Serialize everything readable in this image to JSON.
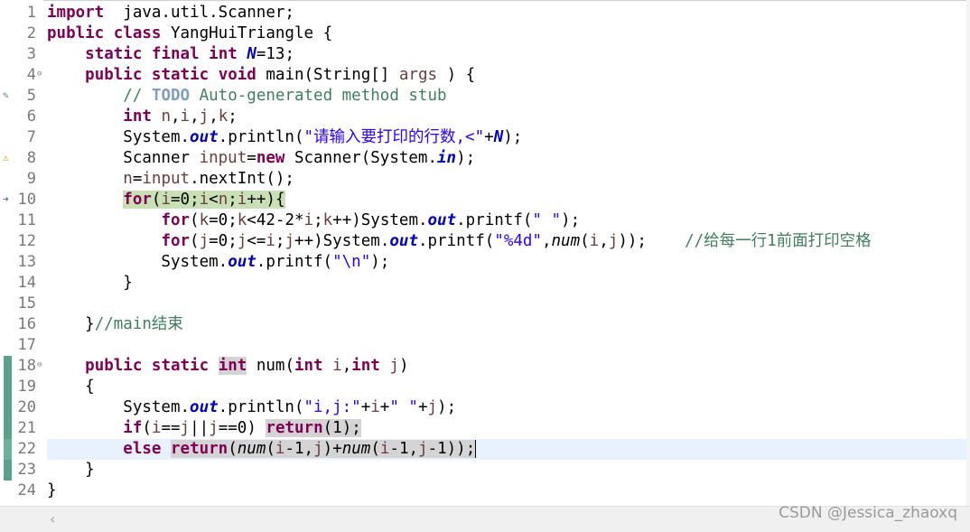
{
  "editor": {
    "lines": [
      {
        "n": "1",
        "parts": [
          [
            "kw",
            "import"
          ],
          [
            "",
            "  java.util.Scanner;"
          ]
        ]
      },
      {
        "n": "2",
        "parts": [
          [
            "kw",
            "public"
          ],
          [
            "",
            " "
          ],
          [
            "kw",
            "class"
          ],
          [
            "",
            " YangHuiTriangle {"
          ]
        ]
      },
      {
        "n": "3",
        "parts": [
          [
            "",
            "    "
          ],
          [
            "kw",
            "static"
          ],
          [
            "",
            " "
          ],
          [
            "kw",
            "final"
          ],
          [
            "",
            " "
          ],
          [
            "kw",
            "int"
          ],
          [
            "",
            " "
          ],
          [
            "fld",
            "N"
          ],
          [
            "",
            "=13;"
          ]
        ]
      },
      {
        "n": "4",
        "parts": [
          [
            "",
            "    "
          ],
          [
            "kw",
            "public"
          ],
          [
            "",
            " "
          ],
          [
            "kw",
            "static"
          ],
          [
            "",
            " "
          ],
          [
            "kw",
            "void"
          ],
          [
            "",
            " main(String[] "
          ],
          [
            "var",
            "args"
          ],
          [
            "",
            " ) {"
          ]
        ]
      },
      {
        "n": "5",
        "parts": [
          [
            "",
            "        "
          ],
          [
            "cmt",
            "// "
          ],
          [
            "todo",
            "TODO"
          ],
          [
            "cmt",
            " Auto-generated method stub"
          ]
        ]
      },
      {
        "n": "6",
        "parts": [
          [
            "",
            "        "
          ],
          [
            "kw",
            "int"
          ],
          [
            "",
            " "
          ],
          [
            "var",
            "n"
          ],
          [
            "",
            ","
          ],
          [
            "var",
            "i"
          ],
          [
            "",
            ","
          ],
          [
            "var",
            "j"
          ],
          [
            "",
            ","
          ],
          [
            "var",
            "k"
          ],
          [
            "",
            ";"
          ]
        ]
      },
      {
        "n": "7",
        "parts": [
          [
            "",
            "        System."
          ],
          [
            "fld",
            "out"
          ],
          [
            "",
            ".println("
          ],
          [
            "str",
            "\"请输入要打印的行数,<\""
          ],
          [
            "",
            "+"
          ],
          [
            "fld",
            "N"
          ],
          [
            "",
            ");"
          ]
        ]
      },
      {
        "n": "8",
        "parts": [
          [
            "",
            "        Scanner "
          ],
          [
            "var",
            "input"
          ],
          [
            "",
            "="
          ],
          [
            "kw",
            "new"
          ],
          [
            "",
            " Scanner(System."
          ],
          [
            "fld",
            "in"
          ],
          [
            "",
            ");"
          ]
        ]
      },
      {
        "n": "9",
        "parts": [
          [
            "",
            "        "
          ],
          [
            "var",
            "n"
          ],
          [
            "",
            "="
          ],
          [
            "var",
            "input"
          ],
          [
            "",
            ".nextInt();"
          ]
        ]
      },
      {
        "n": "10",
        "parts": [
          [
            "",
            "        "
          ],
          [
            "hlkw",
            "for"
          ],
          [
            "hl",
            "("
          ],
          [
            "hlvar",
            "i"
          ],
          [
            "hl",
            "=0;"
          ],
          [
            "hlvar",
            "i"
          ],
          [
            "hl",
            "<"
          ],
          [
            "hlvar",
            "n"
          ],
          [
            "hl",
            ";"
          ],
          [
            "hlvar",
            "i"
          ],
          [
            "hl",
            "++){"
          ]
        ]
      },
      {
        "n": "11",
        "parts": [
          [
            "",
            "            "
          ],
          [
            "kw",
            "for"
          ],
          [
            "",
            "("
          ],
          [
            "var",
            "k"
          ],
          [
            "",
            "=0;"
          ],
          [
            "var",
            "k"
          ],
          [
            "",
            "<42-2*"
          ],
          [
            "var",
            "i"
          ],
          [
            "",
            ";"
          ],
          [
            "var",
            "k"
          ],
          [
            "",
            "++)System."
          ],
          [
            "fld",
            "out"
          ],
          [
            "",
            ".printf("
          ],
          [
            "str",
            "\" \""
          ],
          [
            "",
            ");"
          ]
        ]
      },
      {
        "n": "12",
        "parts": [
          [
            "",
            "            "
          ],
          [
            "kw",
            "for"
          ],
          [
            "",
            "("
          ],
          [
            "var",
            "j"
          ],
          [
            "",
            "=0;"
          ],
          [
            "var",
            "j"
          ],
          [
            "",
            "<="
          ],
          [
            "var",
            "i"
          ],
          [
            "",
            ";"
          ],
          [
            "var",
            "j"
          ],
          [
            "",
            "++)System."
          ],
          [
            "fld",
            "out"
          ],
          [
            "",
            ".printf("
          ],
          [
            "str",
            "\"%4d\""
          ],
          [
            "",
            ","
          ],
          [
            "mcall",
            "num"
          ],
          [
            "",
            "("
          ],
          [
            "var",
            "i"
          ],
          [
            "",
            ","
          ],
          [
            "var",
            "j"
          ],
          [
            "",
            "));    "
          ],
          [
            "cmt",
            "//给每一行1前面打印空格"
          ]
        ]
      },
      {
        "n": "13",
        "parts": [
          [
            "",
            "            System."
          ],
          [
            "fld",
            "out"
          ],
          [
            "",
            ".printf("
          ],
          [
            "str",
            "\"\\n\""
          ],
          [
            "",
            ");"
          ]
        ]
      },
      {
        "n": "14",
        "parts": [
          [
            "",
            "        }"
          ]
        ]
      },
      {
        "n": "15",
        "parts": []
      },
      {
        "n": "16",
        "parts": [
          [
            "",
            "    }"
          ],
          [
            "cmt",
            "//main结束"
          ]
        ]
      },
      {
        "n": "17",
        "parts": []
      },
      {
        "n": "18",
        "parts": [
          [
            "",
            "    "
          ],
          [
            "kw",
            "public"
          ],
          [
            "",
            " "
          ],
          [
            "kw",
            "static"
          ],
          [
            "",
            " "
          ],
          [
            "gkw",
            "int"
          ],
          [
            "",
            " num("
          ],
          [
            "kw",
            "int"
          ],
          [
            "",
            " "
          ],
          [
            "var",
            "i"
          ],
          [
            "",
            ","
          ],
          [
            "kw",
            "int"
          ],
          [
            "",
            " "
          ],
          [
            "var",
            "j"
          ],
          [
            "",
            ")"
          ]
        ]
      },
      {
        "n": "19",
        "parts": [
          [
            "",
            "    {"
          ]
        ]
      },
      {
        "n": "20",
        "parts": [
          [
            "",
            "        System."
          ],
          [
            "fld",
            "out"
          ],
          [
            "",
            ".println("
          ],
          [
            "str",
            "\"i,j:\""
          ],
          [
            "",
            "+"
          ],
          [
            "var",
            "i"
          ],
          [
            "",
            "+"
          ],
          [
            "str",
            "\" \""
          ],
          [
            "",
            "+"
          ],
          [
            "var",
            "j"
          ],
          [
            "",
            ");"
          ]
        ]
      },
      {
        "n": "21",
        "parts": [
          [
            "",
            "        "
          ],
          [
            "kw",
            "if"
          ],
          [
            "",
            "("
          ],
          [
            "var",
            "i"
          ],
          [
            "",
            "=="
          ],
          [
            "var",
            "j"
          ],
          [
            "",
            "||"
          ],
          [
            "var",
            "j"
          ],
          [
            "",
            "==0) "
          ],
          [
            "gkw",
            "return"
          ],
          [
            "g",
            "(1);"
          ]
        ]
      },
      {
        "n": "22",
        "parts": [
          [
            "",
            "        "
          ],
          [
            "kw",
            "else"
          ],
          [
            "",
            " "
          ],
          [
            "gkw",
            "return"
          ],
          [
            "g",
            "("
          ],
          [
            "gmcall",
            "num"
          ],
          [
            "g",
            "("
          ],
          [
            "gvar",
            "i"
          ],
          [
            "g",
            "-1,"
          ],
          [
            "gvar",
            "j"
          ],
          [
            "g",
            ")+"
          ],
          [
            "gmcall",
            "num"
          ],
          [
            "g",
            "("
          ],
          [
            "gvar",
            "i"
          ],
          [
            "g",
            "-1,"
          ],
          [
            "gvar",
            "j"
          ],
          [
            "g",
            "-1));"
          ],
          [
            "cursor",
            ""
          ]
        ]
      },
      {
        "n": "23",
        "parts": [
          [
            "",
            "    }"
          ]
        ]
      },
      {
        "n": "24",
        "parts": [
          [
            "",
            "}"
          ]
        ]
      }
    ]
  },
  "watermark": "CSDN @Jessica_zhaoxq",
  "scroll_left_glyph": "‹",
  "colors": {
    "keyword": "#7f0055",
    "field": "#0000c0",
    "string": "#2a00ff",
    "comment": "#3f7f5f",
    "highlight_line": "#c8e0b4",
    "occurrence": "#d4d4d4"
  }
}
